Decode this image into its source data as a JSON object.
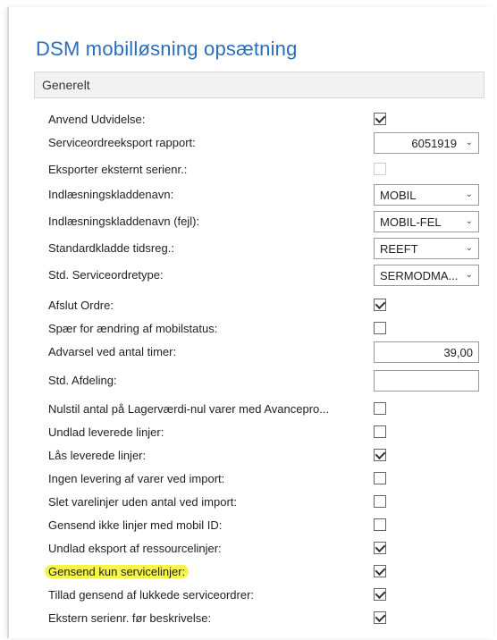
{
  "page": {
    "title": "DSM mobilløsning opsætning"
  },
  "section": {
    "title": "Generelt"
  },
  "fields": {
    "anvend_udvidelse": {
      "label": "Anvend Udvidelse:",
      "checked": true
    },
    "serviceordre_rapport": {
      "label": "Serviceordreeksport rapport:",
      "value": "6051919"
    },
    "eksporter_serienr": {
      "label": "Eksporter eksternt serienr.:",
      "checked": false,
      "disabled": true
    },
    "indl_kladde": {
      "label": "Indlæsningskladdenavn:",
      "value": "MOBIL"
    },
    "indl_kladde_fejl": {
      "label": "Indlæsningskladdenavn (fejl):",
      "value": "MOBIL-FEL"
    },
    "standardkladde": {
      "label": "Standardkladde tidsreg.:",
      "value": "REEFT"
    },
    "std_serviceordretype": {
      "label": "Std. Serviceordretype:",
      "value": "SERMODMA..."
    },
    "afslut_ordre": {
      "label": "Afslut Ordre:",
      "checked": true
    },
    "spaer_mobilstatus": {
      "label": "Spær for ændring af mobilstatus:",
      "checked": false
    },
    "advarsel_timer": {
      "label": "Advarsel ved antal timer:",
      "value": "39,00"
    },
    "std_afdeling": {
      "label": "Std. Afdeling:",
      "value": ""
    },
    "nulstil_antal": {
      "label": "Nulstil antal på Lagerværdi-nul varer med Avancepro...",
      "checked": false
    },
    "undlad_leverede": {
      "label": "Undlad leverede linjer:",
      "checked": false
    },
    "laas_leverede": {
      "label": "Lås leverede linjer:",
      "checked": true
    },
    "ingen_levering": {
      "label": "Ingen levering af varer ved import:",
      "checked": false
    },
    "slet_varelinjer": {
      "label": "Slet varelinjer uden antal ved import:",
      "checked": false
    },
    "gensend_mobil_id": {
      "label": "Gensend ikke linjer med mobil ID:",
      "checked": false
    },
    "undlad_ressource": {
      "label": "Undlad eksport af ressourcelinjer:",
      "checked": true
    },
    "gensend_service": {
      "label": "Gensend kun servicelinjer:",
      "checked": true,
      "highlighted": true
    },
    "tillad_gensend": {
      "label": "Tillad gensend af lukkede serviceordrer:",
      "checked": true
    },
    "ekstern_serienr": {
      "label": "Ekstern serienr. før beskrivelse:",
      "checked": true
    }
  },
  "colors": {
    "title": "#2a6ebb",
    "highlight": "#f7f54a"
  }
}
